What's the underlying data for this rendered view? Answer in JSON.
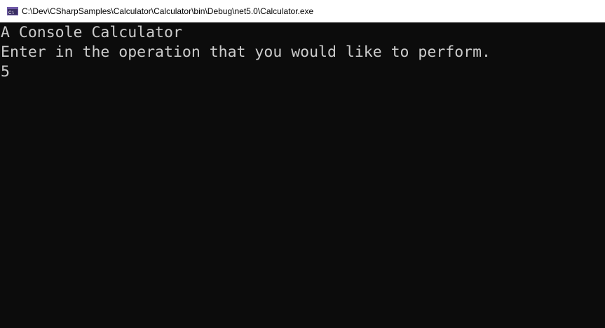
{
  "window": {
    "title": "C:\\Dev\\CSharpSamples\\Calculator\\Calculator\\bin\\Debug\\net5.0\\Calculator.exe",
    "icon": "console-app-icon",
    "icon_text": "C:\\"
  },
  "console": {
    "lines": [
      "A Console Calculator",
      "Enter in the operation that you would like to perform.",
      "5"
    ]
  },
  "colors": {
    "console_background": "#0c0c0c",
    "console_text": "#cccccc",
    "titlebar_background": "#ffffff",
    "icon_accent": "#6f5aa8"
  }
}
